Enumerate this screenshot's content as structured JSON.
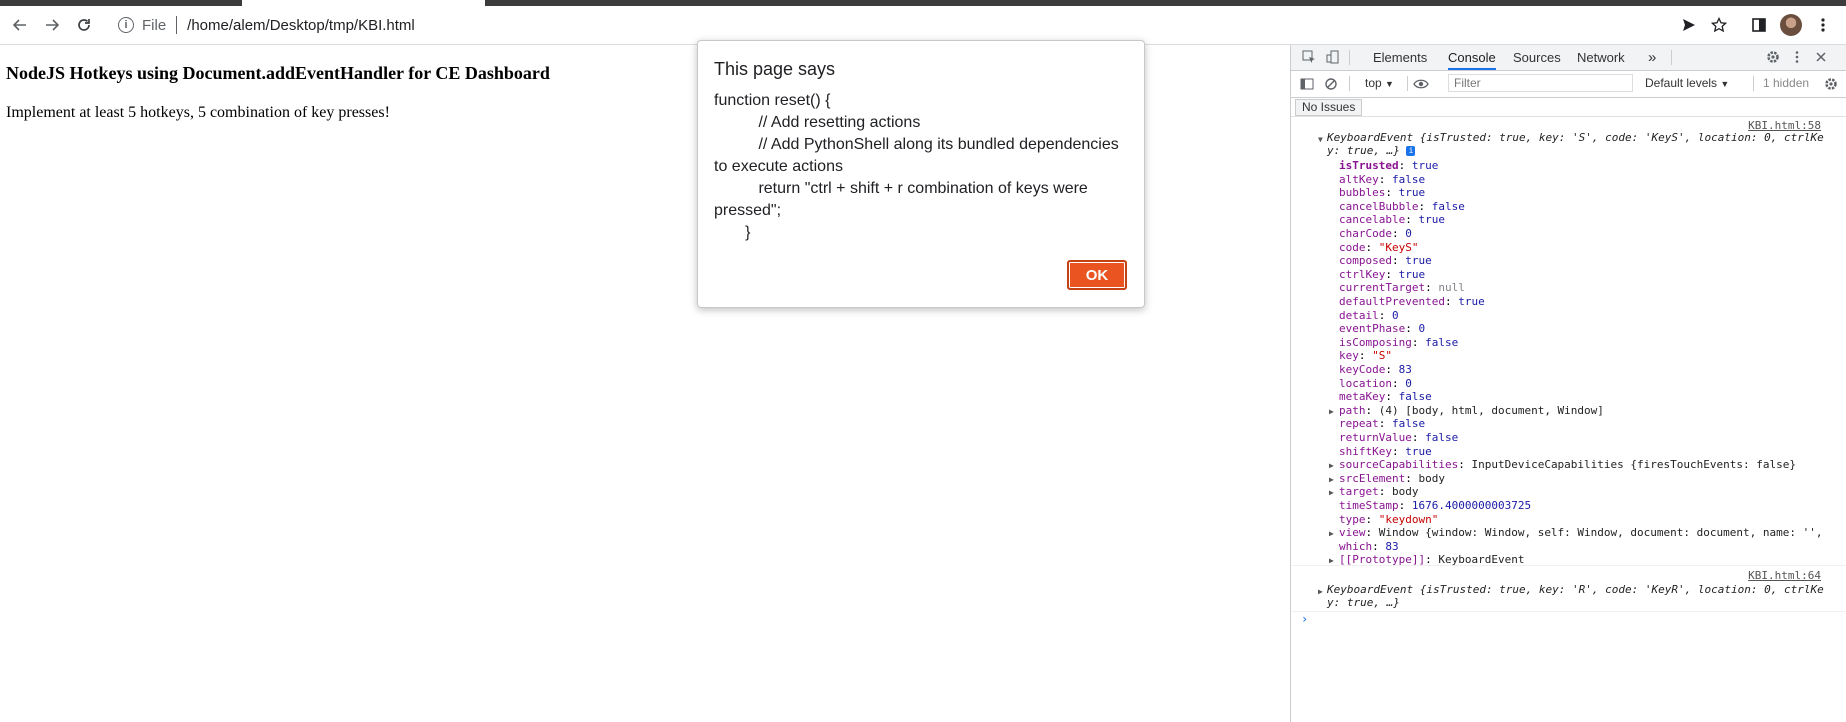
{
  "browser": {
    "url": "/home/alem/Desktop/tmp/KBI.html",
    "scheme_label": "File"
  },
  "page": {
    "heading": "NodeJS Hotkeys using Document.addEventHandler for CE Dashboard",
    "text": "Implement at least 5 hotkeys, 5 combination of key presses!"
  },
  "dialog": {
    "title": "This page says",
    "message": "function reset() {\n          // Add resetting actions\n          // Add PythonShell along its bundled dependencies to execute actions\n          return \"ctrl + shift + r combination of keys were pressed\";\n       }",
    "ok_label": "OK"
  },
  "devtools": {
    "tabs": [
      "Elements",
      "Console",
      "Sources",
      "Network"
    ],
    "active_tab": "Console",
    "more_tabs": "»",
    "context": "top",
    "filter_placeholder": "Filter",
    "levels": "Default levels",
    "hidden": "1 hidden",
    "issues": "No Issues",
    "messages": [
      {
        "source": "KBI.html:58",
        "summary_line1": "KeyboardEvent {isTrusted: true, key: 'S', code: 'KeyS', location: 0, ctrlKe",
        "summary_line2": "y: true, …}",
        "props": [
          {
            "k": "isTrusted",
            "v": "true",
            "t": "bool",
            "own": true
          },
          {
            "k": "altKey",
            "v": "false",
            "t": "bool"
          },
          {
            "k": "bubbles",
            "v": "true",
            "t": "bool"
          },
          {
            "k": "cancelBubble",
            "v": "false",
            "t": "bool"
          },
          {
            "k": "cancelable",
            "v": "true",
            "t": "bool"
          },
          {
            "k": "charCode",
            "v": "0",
            "t": "num"
          },
          {
            "k": "code",
            "v": "\"KeyS\"",
            "t": "str"
          },
          {
            "k": "composed",
            "v": "true",
            "t": "bool"
          },
          {
            "k": "ctrlKey",
            "v": "true",
            "t": "bool"
          },
          {
            "k": "currentTarget",
            "v": "null",
            "t": "null"
          },
          {
            "k": "defaultPrevented",
            "v": "true",
            "t": "bool"
          },
          {
            "k": "detail",
            "v": "0",
            "t": "num"
          },
          {
            "k": "eventPhase",
            "v": "0",
            "t": "num"
          },
          {
            "k": "isComposing",
            "v": "false",
            "t": "bool"
          },
          {
            "k": "key",
            "v": "\"S\"",
            "t": "str"
          },
          {
            "k": "keyCode",
            "v": "83",
            "t": "num"
          },
          {
            "k": "location",
            "v": "0",
            "t": "num"
          },
          {
            "k": "metaKey",
            "v": "false",
            "t": "bool"
          },
          {
            "k": "path",
            "v": "(4) [body, html, document, Window]",
            "t": "obj",
            "expandable": true
          },
          {
            "k": "repeat",
            "v": "false",
            "t": "bool"
          },
          {
            "k": "returnValue",
            "v": "false",
            "t": "bool"
          },
          {
            "k": "shiftKey",
            "v": "true",
            "t": "bool"
          },
          {
            "k": "sourceCapabilities",
            "v": "InputDeviceCapabilities {firesTouchEvents: false}",
            "t": "obj",
            "expandable": true
          },
          {
            "k": "srcElement",
            "v": "body",
            "t": "obj",
            "expandable": true
          },
          {
            "k": "target",
            "v": "body",
            "t": "obj",
            "expandable": true
          },
          {
            "k": "timeStamp",
            "v": "1676.4000000003725",
            "t": "num"
          },
          {
            "k": "type",
            "v": "\"keydown\"",
            "t": "str"
          },
          {
            "k": "view",
            "v": "Window {window: Window, self: Window, document: document, name: '',",
            "t": "obj",
            "expandable": true
          },
          {
            "k": "which",
            "v": "83",
            "t": "num"
          },
          {
            "k": "[[Prototype]]",
            "v": "KeyboardEvent",
            "t": "obj",
            "expandable": true
          }
        ]
      },
      {
        "source": "KBI.html:64",
        "summary_line1": "KeyboardEvent {isTrusted: true, key: 'R', code: 'KeyR', location: 0, ctrlKe",
        "summary_line2": "y: true, …}"
      }
    ],
    "prompt": "›"
  }
}
